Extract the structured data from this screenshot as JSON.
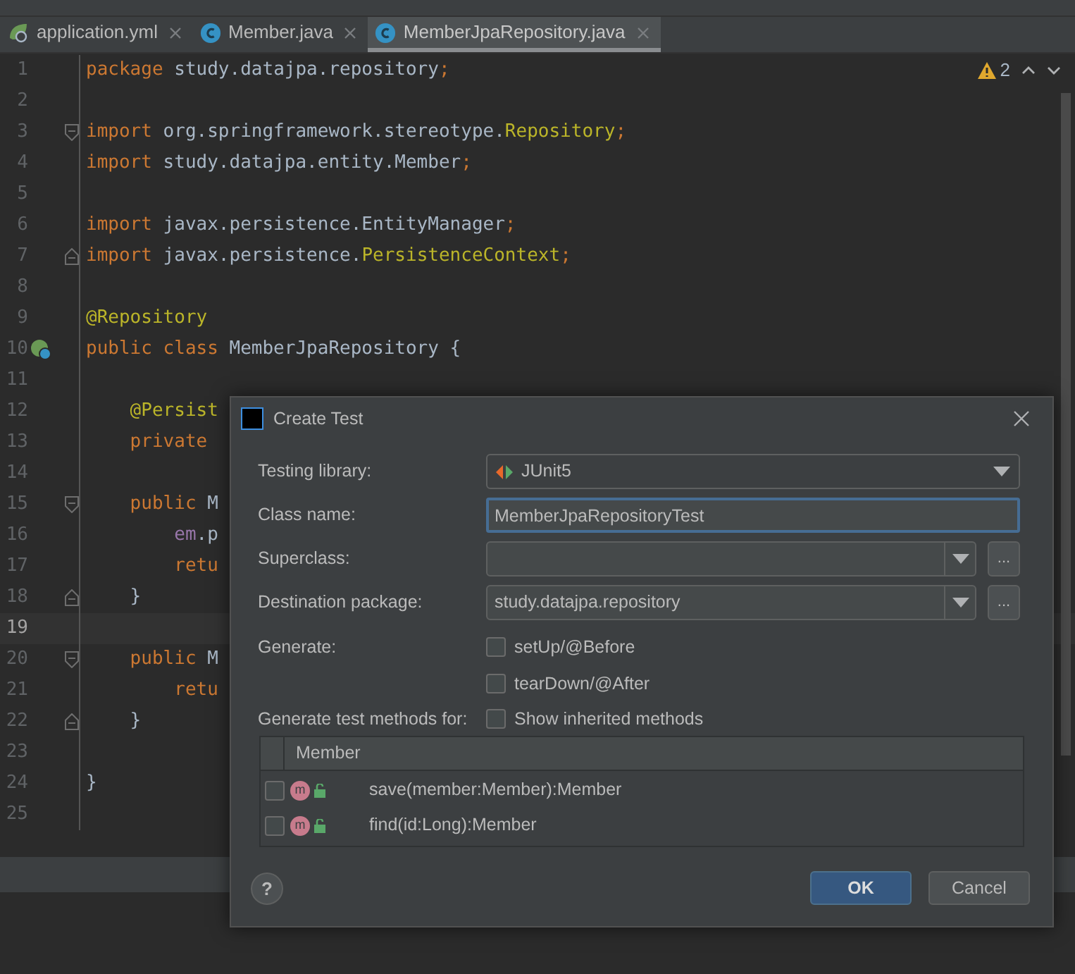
{
  "tabs": [
    {
      "label": "application.yml",
      "kind": "spring",
      "selected": false
    },
    {
      "label": "Member.java",
      "kind": "class",
      "selected": false
    },
    {
      "label": "MemberJpaRepository.java",
      "kind": "class",
      "selected": true
    }
  ],
  "inspections": {
    "warnings": "2"
  },
  "editor": {
    "lines": [
      {
        "number": "1",
        "tokens": [
          {
            "kind": "keyword",
            "text": "package"
          },
          {
            "kind": "plain",
            "text": " study.datajpa.repository"
          },
          {
            "kind": "keyword",
            "text": ";"
          }
        ]
      },
      {
        "number": "2"
      },
      {
        "number": "3",
        "fold_start": true,
        "tokens": [
          {
            "kind": "keyword",
            "text": "import"
          },
          {
            "kind": "plain",
            "text": " org.springframework.stereotype."
          },
          {
            "kind": "annotation",
            "text": "Repository"
          },
          {
            "kind": "keyword",
            "text": ";"
          }
        ]
      },
      {
        "number": "4",
        "tokens": [
          {
            "kind": "keyword",
            "text": "import"
          },
          {
            "kind": "plain",
            "text": " study.datajpa.entity.Member"
          },
          {
            "kind": "keyword",
            "text": ";"
          }
        ]
      },
      {
        "number": "5"
      },
      {
        "number": "6",
        "tokens": [
          {
            "kind": "keyword",
            "text": "import"
          },
          {
            "kind": "plain",
            "text": " javax.persistence.EntityManager"
          },
          {
            "kind": "keyword",
            "text": ";"
          }
        ]
      },
      {
        "number": "7",
        "fold_end": true,
        "tokens": [
          {
            "kind": "keyword",
            "text": "import"
          },
          {
            "kind": "plain",
            "text": " javax.persistence."
          },
          {
            "kind": "annotation",
            "text": "PersistenceContext"
          },
          {
            "kind": "keyword",
            "text": ";"
          }
        ]
      },
      {
        "number": "8"
      },
      {
        "number": "9",
        "tokens": [
          {
            "kind": "annotation",
            "text": "@Repository"
          }
        ]
      },
      {
        "number": "10",
        "bean": true,
        "tokens": [
          {
            "kind": "keyword",
            "text": "public class"
          },
          {
            "kind": "plain",
            "text": " MemberJpaRepository {"
          }
        ]
      },
      {
        "number": "11"
      },
      {
        "number": "12",
        "tokens": [
          {
            "kind": "annotation",
            "text": "    @Persist"
          }
        ]
      },
      {
        "number": "13",
        "tokens": [
          {
            "kind": "keyword",
            "text": "    private"
          }
        ]
      },
      {
        "number": "14"
      },
      {
        "number": "15",
        "fold_start": true,
        "tokens": [
          {
            "kind": "keyword",
            "text": "    public"
          },
          {
            "kind": "plain",
            "text": " M"
          }
        ]
      },
      {
        "number": "16",
        "tokens": [
          {
            "kind": "field",
            "text": "        em"
          },
          {
            "kind": "plain",
            "text": ".p"
          }
        ]
      },
      {
        "number": "17",
        "tokens": [
          {
            "kind": "keyword",
            "text": "        retu"
          }
        ]
      },
      {
        "number": "18",
        "fold_end": true,
        "tokens": [
          {
            "kind": "plain",
            "text": "    }"
          }
        ]
      },
      {
        "number": "19",
        "current": true
      },
      {
        "number": "20",
        "fold_start": true,
        "tokens": [
          {
            "kind": "keyword",
            "text": "    public"
          },
          {
            "kind": "plain",
            "text": " M"
          }
        ]
      },
      {
        "number": "21",
        "tokens": [
          {
            "kind": "keyword",
            "text": "        retu"
          }
        ]
      },
      {
        "number": "22",
        "fold_end": true,
        "tokens": [
          {
            "kind": "plain",
            "text": "    }"
          }
        ]
      },
      {
        "number": "23"
      },
      {
        "number": "24",
        "tokens": [
          {
            "kind": "plain",
            "text": "}"
          }
        ]
      },
      {
        "number": "25"
      }
    ]
  },
  "dialog": {
    "title": "Create Test",
    "testing_library": {
      "label": "Testing library:",
      "value": "JUnit5"
    },
    "class_name": {
      "label": "Class name:",
      "value": "MemberJpaRepositoryTest"
    },
    "superclass": {
      "label": "Superclass:",
      "browse": "..."
    },
    "destination_package": {
      "label": "Destination package:",
      "value": "study.datajpa.repository",
      "browse": "..."
    },
    "generate": {
      "label": "Generate:",
      "options": [
        {
          "label": "setUp/@Before",
          "checked": false
        },
        {
          "label": "tearDown/@After",
          "checked": false
        }
      ]
    },
    "methods": {
      "label": "Generate test methods for:",
      "show_inherited": {
        "label": "Show inherited methods",
        "checked": false
      },
      "column": "Member",
      "rows": [
        {
          "method": "save(member:Member):Member",
          "checked": false,
          "badge": "m"
        },
        {
          "method": "find(id:Long):Member",
          "checked": false,
          "badge": "m"
        }
      ]
    },
    "help": "?",
    "buttons": [
      {
        "label": "OK",
        "kind": "primary"
      },
      {
        "label": "Cancel",
        "kind": "secondary"
      }
    ]
  }
}
